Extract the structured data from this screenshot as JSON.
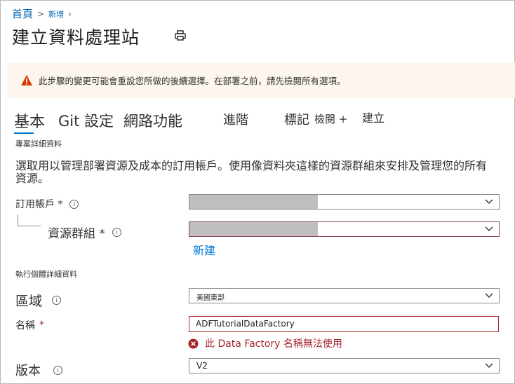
{
  "breadcrumb": {
    "home": "首頁",
    "current": "新增"
  },
  "page": {
    "title": "建立資料處理站"
  },
  "warning": {
    "text": "此步驟的變更可能會重設您所做的後續選擇。在部署之前，請先檢閱所有選項。"
  },
  "tabs": {
    "basic": "基本",
    "git": "Git 設定",
    "network": "網路功能",
    "advanced": "進階",
    "tags": "標記",
    "review": "檢閱 +",
    "create": "建立"
  },
  "project": {
    "heading": "專案詳細資料",
    "description": "選取用以管理部署資源及成本的訂用帳戶。使用像資料夾這樣的資源群組來安排及管理您的所有資源。",
    "subscription_label": "訂用帳戶 *",
    "resource_group_label": "資源群組 *",
    "new_link": "新建"
  },
  "instance": {
    "heading": "執行個體詳細資料",
    "region_label": "區域",
    "region_value": "美國東部",
    "name_label": "名稱",
    "name_required": "*",
    "name_value": "ADFTutorialDataFactory",
    "name_error": "此 Data Factory 名稱無法使用",
    "version_label": "版本",
    "version_value": "V2"
  },
  "icons": {
    "print": "print-icon",
    "warning": "warning-icon",
    "info": "info-icon",
    "chevron": "chevron-down-icon",
    "error": "error-icon"
  },
  "colors": {
    "link": "#0078d4",
    "warning_bg": "#fdf6ef",
    "warning_icon": "#d83b01",
    "error": "#a4262c"
  }
}
